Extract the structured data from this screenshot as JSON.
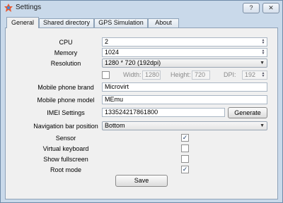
{
  "window": {
    "title": "Settings",
    "help_label": "?",
    "close_label": "✕"
  },
  "tabs": [
    "General",
    "Shared directory",
    "GPS Simulation",
    "About"
  ],
  "form": {
    "cpu": {
      "label": "CPU",
      "value": "2"
    },
    "memory": {
      "label": "Memory",
      "value": "1024"
    },
    "resolution": {
      "label": "Resolution",
      "value": "1280 * 720 (192dpi)"
    },
    "custom": {
      "width_label": "Width:",
      "width_value": "1280",
      "height_label": "Height:",
      "height_value": "720",
      "dpi_label": "DPI:",
      "dpi_value": "192"
    },
    "brand": {
      "label": "Mobile phone brand",
      "value": "Microvirt"
    },
    "model": {
      "label": "Mobile phone model",
      "value": "MEmu"
    },
    "imei": {
      "label": "IMEI Settings",
      "value": "133524217861800",
      "button": "Generate"
    },
    "navbar": {
      "label": "Navigation bar position",
      "value": "Bottom"
    },
    "sensor": {
      "label": "Sensor",
      "checked": true
    },
    "virtual_keyboard": {
      "label": "Virtual keyboard",
      "checked": false
    },
    "fullscreen": {
      "label": "Show fullscreen",
      "checked": false
    },
    "root": {
      "label": "Root mode",
      "checked": true
    },
    "save_label": "Save"
  },
  "colors": {
    "accent": "#1c3e6a",
    "frame": "#c9d9ea",
    "panel": "#f0f0f0"
  }
}
